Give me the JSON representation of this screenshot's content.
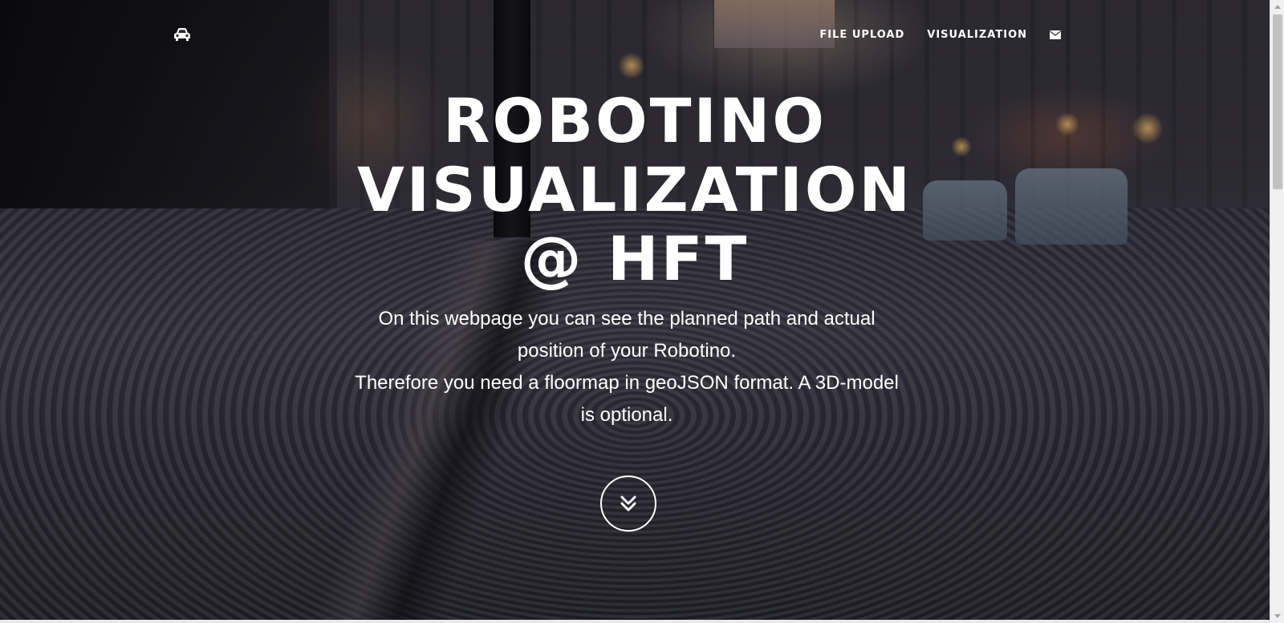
{
  "navbar": {
    "brand_icon": "car-icon",
    "links": [
      {
        "label": "FILE UPLOAD"
      },
      {
        "label": "VISUALIZATION"
      }
    ],
    "contact_icon": "envelope-icon"
  },
  "hero": {
    "title_lines": [
      "ROBOTINO",
      "VISUALIZATION",
      "@ HFT"
    ],
    "text_lines": [
      "On this webpage you can see the planned path and actual",
      "position of your Robotino.",
      "Therefore you need a floormap in geoJSON format. A 3D-model",
      "is optional."
    ],
    "scroll_icon": "double-chevron-down-icon"
  },
  "colors": {
    "text": "#ffffff",
    "overlay": "rgba(0,0,0,0.28)"
  }
}
